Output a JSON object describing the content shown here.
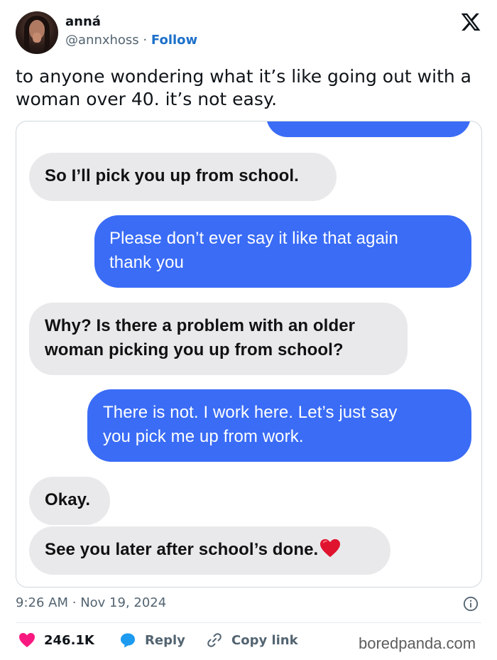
{
  "author": {
    "name": "anná",
    "handle": "@annxhoss",
    "separator": "·",
    "follow_label": "Follow"
  },
  "tweet": {
    "text": "to anyone wondering what it’s like going out with a woman over 40. it’s not easy."
  },
  "conversation": {
    "messages": [
      {
        "side": "incoming",
        "text": "So I’ll pick you up from school."
      },
      {
        "side": "outgoing",
        "line1": "Please don’t ever say it like that again",
        "line2": "thank you"
      },
      {
        "side": "incoming",
        "line1": "Why? Is there a problem with an older",
        "line2": "woman picking you up from school?"
      },
      {
        "side": "outgoing",
        "line1": "There is not. I work here. Let’s just say",
        "line2": "you pick me up from work."
      },
      {
        "side": "incoming",
        "text": "Okay."
      },
      {
        "side": "incoming",
        "text": "See you later after school’s done."
      }
    ]
  },
  "meta": {
    "time": "9:26 AM",
    "separator": "·",
    "date": "Nov 19, 2024"
  },
  "actions": {
    "likes": "246.1K",
    "reply_label": "Reply",
    "copy_label": "Copy link"
  },
  "watermark": "boredpanda.com",
  "colors": {
    "like": "#f91880",
    "reply": "#1d9bf0",
    "outgoing_bubble": "#3a6cf6",
    "incoming_bubble": "#e9e9eb",
    "follow": "#1d70c9"
  },
  "icons": [
    "x-logo-icon",
    "heart-emoji-icon",
    "info-icon",
    "heart-icon",
    "reply-bubble-icon",
    "link-icon"
  ]
}
